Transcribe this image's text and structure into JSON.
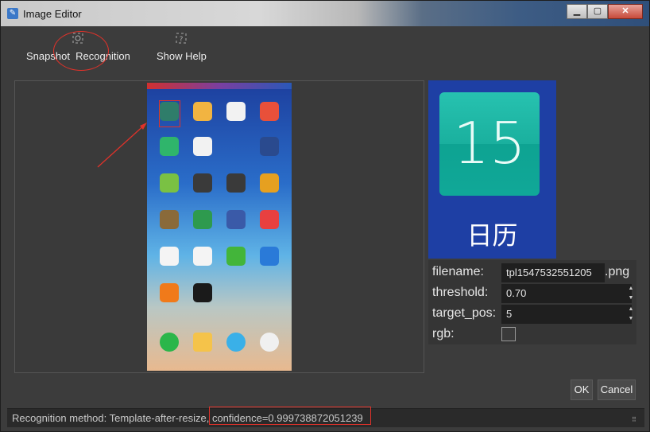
{
  "window": {
    "title": "Image Editor",
    "minimize_glyph": "▁",
    "maximize_glyph": "▢",
    "close_glyph": "✕"
  },
  "toolbar": {
    "snapshot_label": "Snapshot  Recognition",
    "help_label": "Show Help",
    "snapshot_icon": "snapshot-recognition-icon",
    "help_icon": "help-icon"
  },
  "template": {
    "calendar_day": "15",
    "calendar_name": "日历"
  },
  "properties": {
    "filename_label": "filename:",
    "filename_value": "tpl1547532551205",
    "filename_suffix": ".png",
    "threshold_label": "threshold:",
    "threshold_value": "0.70",
    "target_pos_label": "target_pos:",
    "target_pos_value": "5",
    "rgb_label": "rgb:",
    "rgb_checked": false
  },
  "buttons": {
    "ok": "OK",
    "cancel": "Cancel"
  },
  "status": {
    "text": "Recognition method: Template-after-resize, confidence=0.999738872051239"
  },
  "colors": {
    "highlight": "#e0322a",
    "accent": "#1ab09e"
  }
}
